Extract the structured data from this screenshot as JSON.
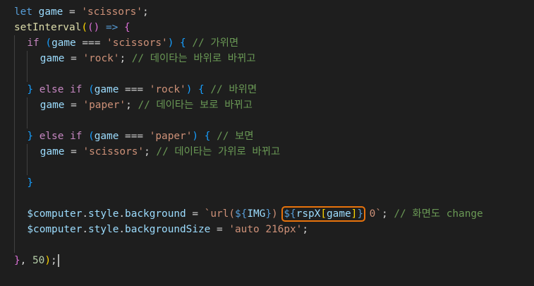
{
  "editor": {
    "language": "javascript",
    "theme": "dark",
    "lines": [
      {
        "indent": 0,
        "tokens": [
          {
            "t": "let",
            "c": "keyword"
          },
          {
            "t": " "
          },
          {
            "t": "game",
            "c": "var"
          },
          {
            "t": " = "
          },
          {
            "t": "'scissors'",
            "c": "string"
          },
          {
            "t": ";"
          }
        ]
      },
      {
        "indent": 0,
        "tokens": [
          {
            "t": "setInterval",
            "c": "func"
          },
          {
            "t": "(",
            "c": "bracket1"
          },
          {
            "t": "()",
            "c": "bracket2"
          },
          {
            "t": " "
          },
          {
            "t": "=>",
            "c": "keyword"
          },
          {
            "t": " "
          },
          {
            "t": "{",
            "c": "bracket2"
          }
        ]
      },
      {
        "indent": 1,
        "tokens": [
          {
            "t": "if",
            "c": "control"
          },
          {
            "t": " "
          },
          {
            "t": "(",
            "c": "bracket3"
          },
          {
            "t": "game",
            "c": "var"
          },
          {
            "t": " === "
          },
          {
            "t": "'scissors'",
            "c": "string"
          },
          {
            "t": ")",
            "c": "bracket3"
          },
          {
            "t": " "
          },
          {
            "t": "{",
            "c": "bracket3"
          },
          {
            "t": " "
          },
          {
            "t": "// 가위면",
            "c": "comment"
          }
        ]
      },
      {
        "indent": 2,
        "tokens": [
          {
            "t": "game",
            "c": "var"
          },
          {
            "t": " = "
          },
          {
            "t": "'rock'",
            "c": "string"
          },
          {
            "t": "; "
          },
          {
            "t": "// 데이타는 바위로 바뀌고",
            "c": "comment"
          }
        ]
      },
      {
        "indent": 0,
        "tokens": []
      },
      {
        "indent": 1,
        "tokens": [
          {
            "t": "}",
            "c": "bracket3"
          },
          {
            "t": " "
          },
          {
            "t": "else",
            "c": "control"
          },
          {
            "t": " "
          },
          {
            "t": "if",
            "c": "control"
          },
          {
            "t": " "
          },
          {
            "t": "(",
            "c": "bracket3"
          },
          {
            "t": "game",
            "c": "var"
          },
          {
            "t": " === "
          },
          {
            "t": "'rock'",
            "c": "string"
          },
          {
            "t": ")",
            "c": "bracket3"
          },
          {
            "t": " "
          },
          {
            "t": "{",
            "c": "bracket3"
          },
          {
            "t": " "
          },
          {
            "t": "// 바위면",
            "c": "comment"
          }
        ]
      },
      {
        "indent": 2,
        "tokens": [
          {
            "t": "game",
            "c": "var"
          },
          {
            "t": " = "
          },
          {
            "t": "'paper'",
            "c": "string"
          },
          {
            "t": "; "
          },
          {
            "t": "// 데이타는 보로 바뀌고",
            "c": "comment"
          }
        ]
      },
      {
        "indent": 0,
        "tokens": []
      },
      {
        "indent": 1,
        "tokens": [
          {
            "t": "}",
            "c": "bracket3"
          },
          {
            "t": " "
          },
          {
            "t": "else",
            "c": "control"
          },
          {
            "t": " "
          },
          {
            "t": "if",
            "c": "control"
          },
          {
            "t": " "
          },
          {
            "t": "(",
            "c": "bracket3"
          },
          {
            "t": "game",
            "c": "var"
          },
          {
            "t": " === "
          },
          {
            "t": "'paper'",
            "c": "string"
          },
          {
            "t": ")",
            "c": "bracket3"
          },
          {
            "t": " "
          },
          {
            "t": "{",
            "c": "bracket3"
          },
          {
            "t": " "
          },
          {
            "t": "// 보면",
            "c": "comment"
          }
        ]
      },
      {
        "indent": 2,
        "tokens": [
          {
            "t": "game",
            "c": "var"
          },
          {
            "t": " = "
          },
          {
            "t": "'scissors'",
            "c": "string"
          },
          {
            "t": "; "
          },
          {
            "t": "// 데이타는 가위로 바뀌고",
            "c": "comment"
          }
        ]
      },
      {
        "indent": 0,
        "tokens": []
      },
      {
        "indent": 1,
        "tokens": [
          {
            "t": "}",
            "c": "bracket3"
          }
        ]
      },
      {
        "indent": 0,
        "tokens": []
      },
      {
        "indent": 1,
        "tokens": [
          {
            "t": "$computer",
            "c": "var"
          },
          {
            "t": "."
          },
          {
            "t": "style",
            "c": "var"
          },
          {
            "t": "."
          },
          {
            "t": "background",
            "c": "var"
          },
          {
            "t": " = "
          },
          {
            "t": "`url(",
            "c": "string"
          },
          {
            "t": "${",
            "c": "keyword"
          },
          {
            "t": "IMG",
            "c": "var"
          },
          {
            "t": "}",
            "c": "keyword"
          },
          {
            "t": ")",
            "c": "string"
          },
          {
            "t": " "
          },
          {
            "t": "${",
            "c": "keyword",
            "box": 1
          },
          {
            "t": "rspX",
            "c": "var",
            "box": 1
          },
          {
            "t": "[",
            "c": "bracket1",
            "box": 1
          },
          {
            "t": "game",
            "c": "var",
            "box": 1
          },
          {
            "t": "]",
            "c": "bracket1",
            "box": 1
          },
          {
            "t": "}",
            "c": "keyword",
            "box": 1
          },
          {
            "t": " 0`",
            "c": "string"
          },
          {
            "t": "; "
          },
          {
            "t": "// 화면도 change",
            "c": "comment"
          }
        ]
      },
      {
        "indent": 1,
        "tokens": [
          {
            "t": "$computer",
            "c": "var"
          },
          {
            "t": "."
          },
          {
            "t": "style",
            "c": "var"
          },
          {
            "t": "."
          },
          {
            "t": "backgroundSize",
            "c": "var"
          },
          {
            "t": " = "
          },
          {
            "t": "'auto 216px'",
            "c": "string"
          },
          {
            "t": ";"
          }
        ]
      },
      {
        "indent": 0,
        "tokens": []
      },
      {
        "indent": 0,
        "cursor": true,
        "tokens": [
          {
            "t": "}",
            "c": "bracket2"
          },
          {
            "t": ", "
          },
          {
            "t": "50",
            "c": "number"
          },
          {
            "t": ")",
            "c": "bracket1"
          },
          {
            "t": ";"
          }
        ]
      }
    ],
    "colors": {
      "background": "#1e1e1e",
      "default": "#d4d4d4",
      "keyword": "#569cd6",
      "control": "#c586c0",
      "var": "#9cdcfe",
      "func": "#dcdcaa",
      "string": "#ce9178",
      "comment": "#6a9955",
      "number": "#b5cea8",
      "bracket1": "#ffd700",
      "bracket2": "#da70d6",
      "bracket3": "#179fff",
      "highlight_box": "#e8730c",
      "indent_guide": "#404040"
    }
  }
}
